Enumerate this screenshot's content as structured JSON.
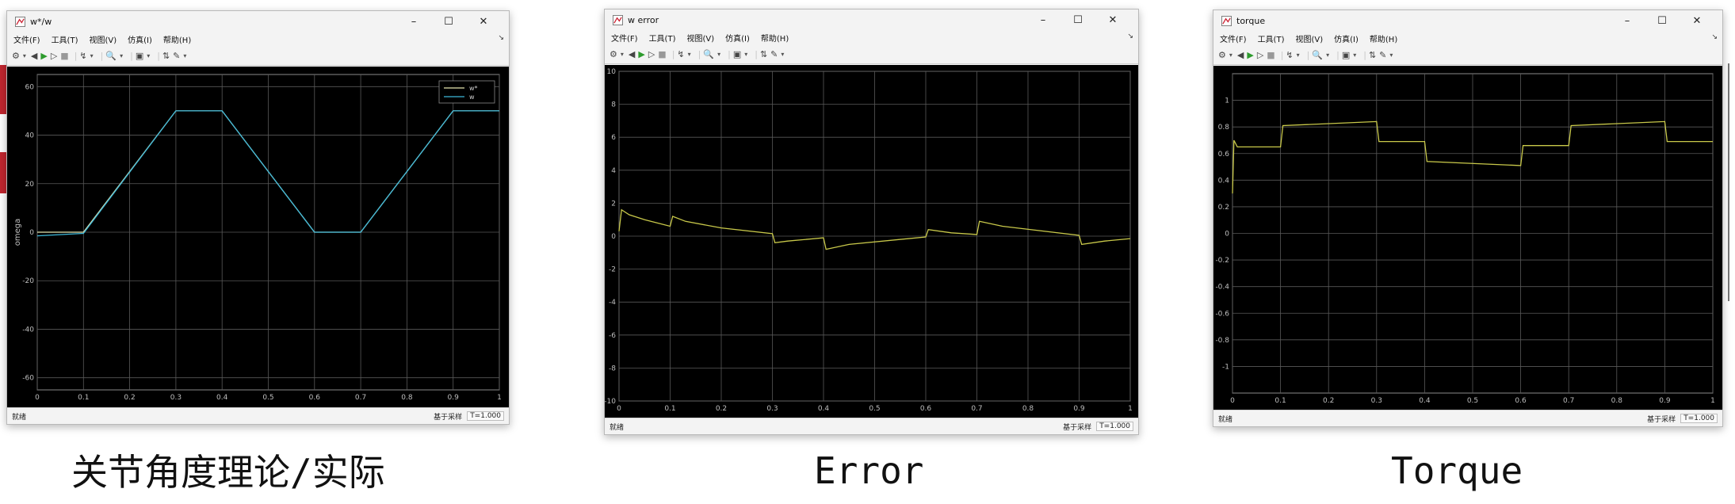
{
  "windows": [
    {
      "title": "w*/w",
      "menu": [
        "文件(F)",
        "工具(T)",
        "视图(V)",
        "仿真(I)",
        "帮助(H)"
      ],
      "status": {
        "left": "就绪",
        "mode": "基于采样",
        "time": "T=1.000"
      },
      "caption": "关节角度理论/实际",
      "colors": {
        "plot_bg": "#000000",
        "grid": "#595959",
        "trace1": "#e6e6b0",
        "trace2": "#3db8d9",
        "tick": "#bfbfbf"
      }
    },
    {
      "title": "w error",
      "menu": [
        "文件(F)",
        "工具(T)",
        "视图(V)",
        "仿真(I)",
        "帮助(H)"
      ],
      "status": {
        "left": "就绪",
        "mode": "基于采样",
        "time": "T=1.000"
      },
      "caption": "Error",
      "colors": {
        "plot_bg": "#000000",
        "grid": "#595959",
        "trace1": "#c9c94a",
        "tick": "#bfbfbf"
      }
    },
    {
      "title": "torque",
      "menu": [
        "文件(F)",
        "工具(T)",
        "视图(V)",
        "仿真(I)",
        "帮助(H)"
      ],
      "status": {
        "left": "就绪",
        "mode": "基于采样",
        "time": "T=1.000"
      },
      "caption": "Torque",
      "colors": {
        "plot_bg": "#000000",
        "grid": "#595959",
        "trace1": "#c9c94a",
        "tick": "#bfbfbf"
      }
    }
  ],
  "toolbar_icons": [
    "settings-gear-icon",
    "dropdown-icon",
    "step-back-icon",
    "run-icon",
    "step-forward-icon",
    "stop-icon",
    "signal-tracing-icon",
    "dropdown-icon",
    "zoom-icon",
    "dropdown-icon",
    "fit-to-view-icon",
    "dropdown-icon",
    "cursor-measure-icon",
    "edit-style-icon",
    "dropdown-icon"
  ],
  "chart_data": [
    {
      "type": "line",
      "title": "",
      "xlabel": "",
      "ylabel": "omega",
      "xlim": [
        0,
        1
      ],
      "ylim": [
        -65,
        65
      ],
      "xticks": [
        "0",
        "0.1",
        "0.2",
        "0.3",
        "0.4",
        "0.5",
        "0.6",
        "0.7",
        "0.8",
        "0.9",
        "1"
      ],
      "yticks": [
        "60",
        "40",
        "20",
        "0",
        "-20",
        "-40",
        "-60"
      ],
      "grid": true,
      "legend": "top-right",
      "series": [
        {
          "name": "w*",
          "x": [
            0,
            0.1,
            0.3,
            0.4,
            0.6,
            0.7,
            0.9,
            1.0
          ],
          "y": [
            0,
            0,
            50,
            50,
            0,
            0,
            50,
            50
          ]
        },
        {
          "name": "w",
          "x": [
            0,
            0.1,
            0.3,
            0.4,
            0.6,
            0.7,
            0.9,
            1.0
          ],
          "y": [
            -1.5,
            -0.5,
            50,
            50,
            0,
            0,
            50,
            50
          ]
        }
      ]
    },
    {
      "type": "line",
      "title": "",
      "xlabel": "",
      "ylabel": "",
      "xlim": [
        0,
        1
      ],
      "ylim": [
        -10,
        10
      ],
      "xticks": [
        "0",
        "0.1",
        "0.2",
        "0.3",
        "0.4",
        "0.5",
        "0.6",
        "0.7",
        "0.8",
        "0.9",
        "1"
      ],
      "yticks": [
        "10",
        "8",
        "6",
        "4",
        "2",
        "0",
        "-2",
        "-4",
        "-6",
        "-8",
        "-10"
      ],
      "grid": true,
      "series": [
        {
          "x": [
            0,
            0.005,
            0.02,
            0.05,
            0.1,
            0.1,
            0.105,
            0.13,
            0.2,
            0.3,
            0.3,
            0.305,
            0.33,
            0.4,
            0.4,
            0.405,
            0.45,
            0.6,
            0.6,
            0.605,
            0.65,
            0.7,
            0.7,
            0.705,
            0.75,
            0.9,
            0.9,
            0.905,
            0.95,
            1.0
          ],
          "y": [
            0.3,
            1.6,
            1.3,
            1.0,
            0.6,
            0.6,
            1.2,
            0.9,
            0.5,
            0.15,
            0.15,
            -0.4,
            -0.3,
            -0.1,
            -0.1,
            -0.8,
            -0.5,
            -0.05,
            -0.05,
            0.4,
            0.2,
            0.1,
            0.1,
            0.9,
            0.6,
            0.05,
            0.05,
            -0.5,
            -0.3,
            -0.15
          ]
        }
      ]
    },
    {
      "type": "line",
      "title": "",
      "xlabel": "",
      "ylabel": "",
      "xlim": [
        0,
        1
      ],
      "ylim": [
        -1.2,
        1.2
      ],
      "xticks": [
        "0",
        "0.1",
        "0.2",
        "0.3",
        "0.4",
        "0.5",
        "0.6",
        "0.7",
        "0.8",
        "0.9",
        "1"
      ],
      "yticks": [
        "1",
        "0.8",
        "0.6",
        "0.4",
        "0.2",
        "0",
        "-0.2",
        "-0.4",
        "-0.6",
        "-0.8",
        "-1"
      ],
      "grid": true,
      "series": [
        {
          "x": [
            0,
            0.003,
            0.01,
            0.1,
            0.1,
            0.105,
            0.3,
            0.3,
            0.305,
            0.4,
            0.4,
            0.405,
            0.6,
            0.6,
            0.605,
            0.7,
            0.7,
            0.705,
            0.9,
            0.9,
            0.905,
            1.0
          ],
          "y": [
            0.3,
            0.7,
            0.65,
            0.65,
            0.65,
            0.81,
            0.84,
            0.84,
            0.69,
            0.69,
            0.69,
            0.54,
            0.51,
            0.51,
            0.66,
            0.66,
            0.66,
            0.81,
            0.84,
            0.84,
            0.69,
            0.69
          ]
        }
      ]
    }
  ]
}
